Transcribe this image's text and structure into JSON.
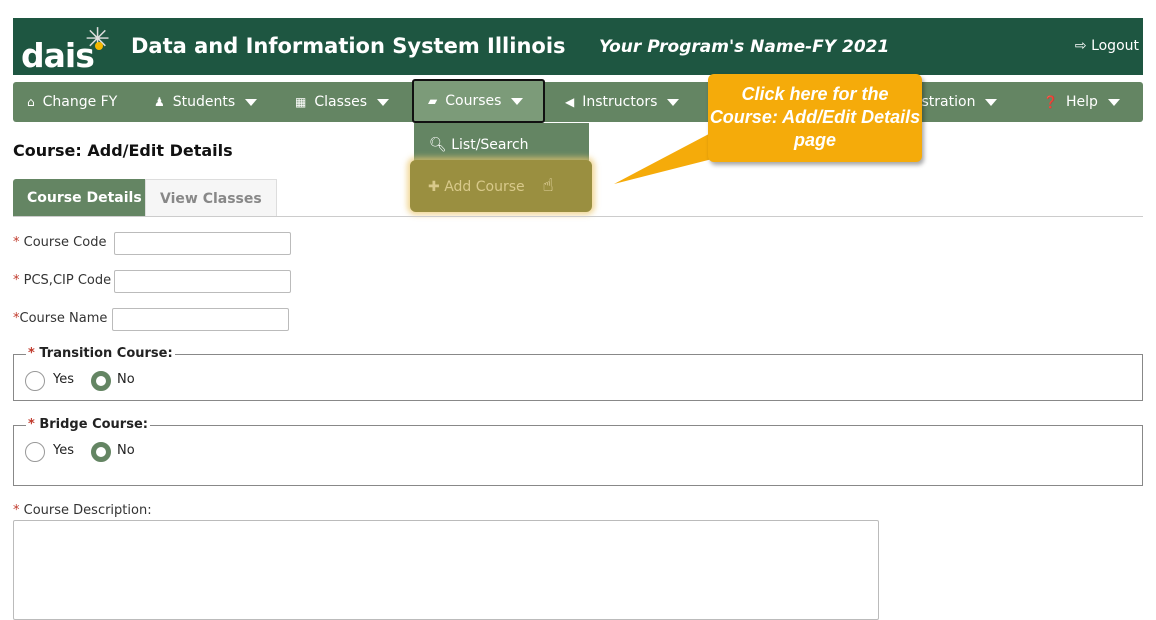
{
  "header": {
    "logo": "daisi",
    "title": "Data and Information System Illinois",
    "program": "Your Program's Name-FY 2021",
    "logout": "Logout"
  },
  "nav": {
    "items": [
      {
        "label": "Change FY",
        "icon": "home-icon"
      },
      {
        "label": "Students",
        "icon": "person-icon"
      },
      {
        "label": "Classes",
        "icon": "building-icon"
      },
      {
        "label": "Courses",
        "icon": "book-icon"
      },
      {
        "label": "Instructors",
        "icon": "bullhorn-icon"
      },
      {
        "label": "Administration",
        "icon": "gear-icon"
      },
      {
        "label": "Help",
        "icon": "question-icon"
      }
    ]
  },
  "dropdown": {
    "items": [
      {
        "label": "List/Search",
        "icon": "search-icon"
      },
      {
        "label": "Add Course",
        "icon": "plus-icon"
      }
    ]
  },
  "callout": {
    "text": "Click here for the Course: Add/Edit Details page",
    "color": "#f5ab0a"
  },
  "page": {
    "title": "Course: Add/Edit Details",
    "tabs": [
      "Course Details",
      "View Classes"
    ]
  },
  "form": {
    "required_mark": "*",
    "course_code": {
      "label": "Course Code",
      "value": ""
    },
    "pcs_cip": {
      "label": "PCS,CIP Code",
      "value": ""
    },
    "course_name": {
      "label": "Course Name",
      "value": ""
    },
    "transition": {
      "legend": "Transition Course:",
      "yes": "Yes",
      "no": "No",
      "selected": "No"
    },
    "bridge": {
      "legend": "Bridge Course:",
      "yes": "Yes",
      "no": "No",
      "selected": "No"
    },
    "description": {
      "label": "Course Description:",
      "value": ""
    }
  },
  "colors": {
    "header": "#1e5641",
    "nav": "#648563",
    "accent": "#f5ab0a"
  }
}
